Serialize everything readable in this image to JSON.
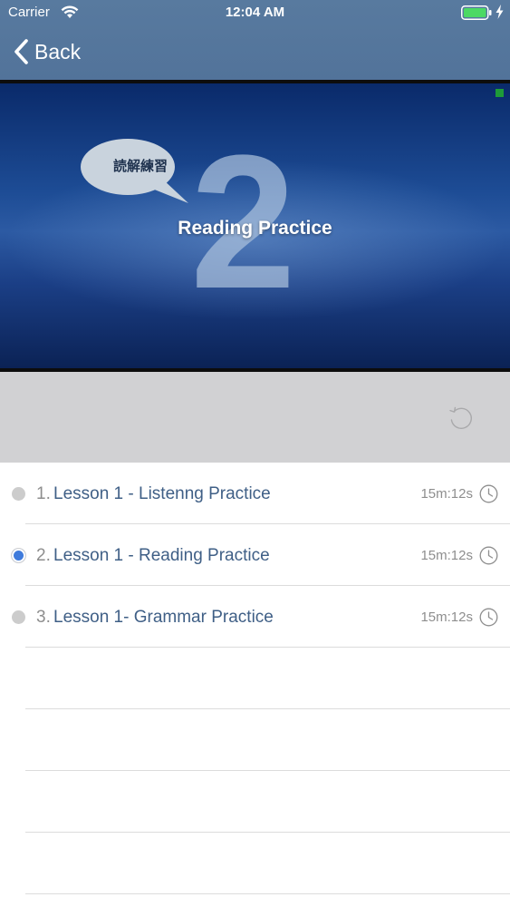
{
  "status_bar": {
    "carrier": "Carrier",
    "time": "12:04 AM",
    "battery_color": "#4cd964"
  },
  "nav": {
    "back_label": "Back"
  },
  "video": {
    "bubble_text": "読解練習",
    "big_number": "2",
    "title": "Reading Practice"
  },
  "controls": {
    "replay_icon": "replay-icon"
  },
  "lessons": [
    {
      "number": "1.",
      "title": "Lesson 1 - Listenng Practice",
      "duration": "15m:12s",
      "active": false
    },
    {
      "number": "2.",
      "title": "Lesson 1 - Reading Practice",
      "duration": "15m:12s",
      "active": true
    },
    {
      "number": "3.",
      "title": "Lesson 1- Grammar Practice",
      "duration": "15m:12s",
      "active": false
    }
  ],
  "colors": {
    "nav_bar": "#587a9f",
    "active_dot": "#3f7bdc",
    "lesson_title": "#3f5f86"
  }
}
